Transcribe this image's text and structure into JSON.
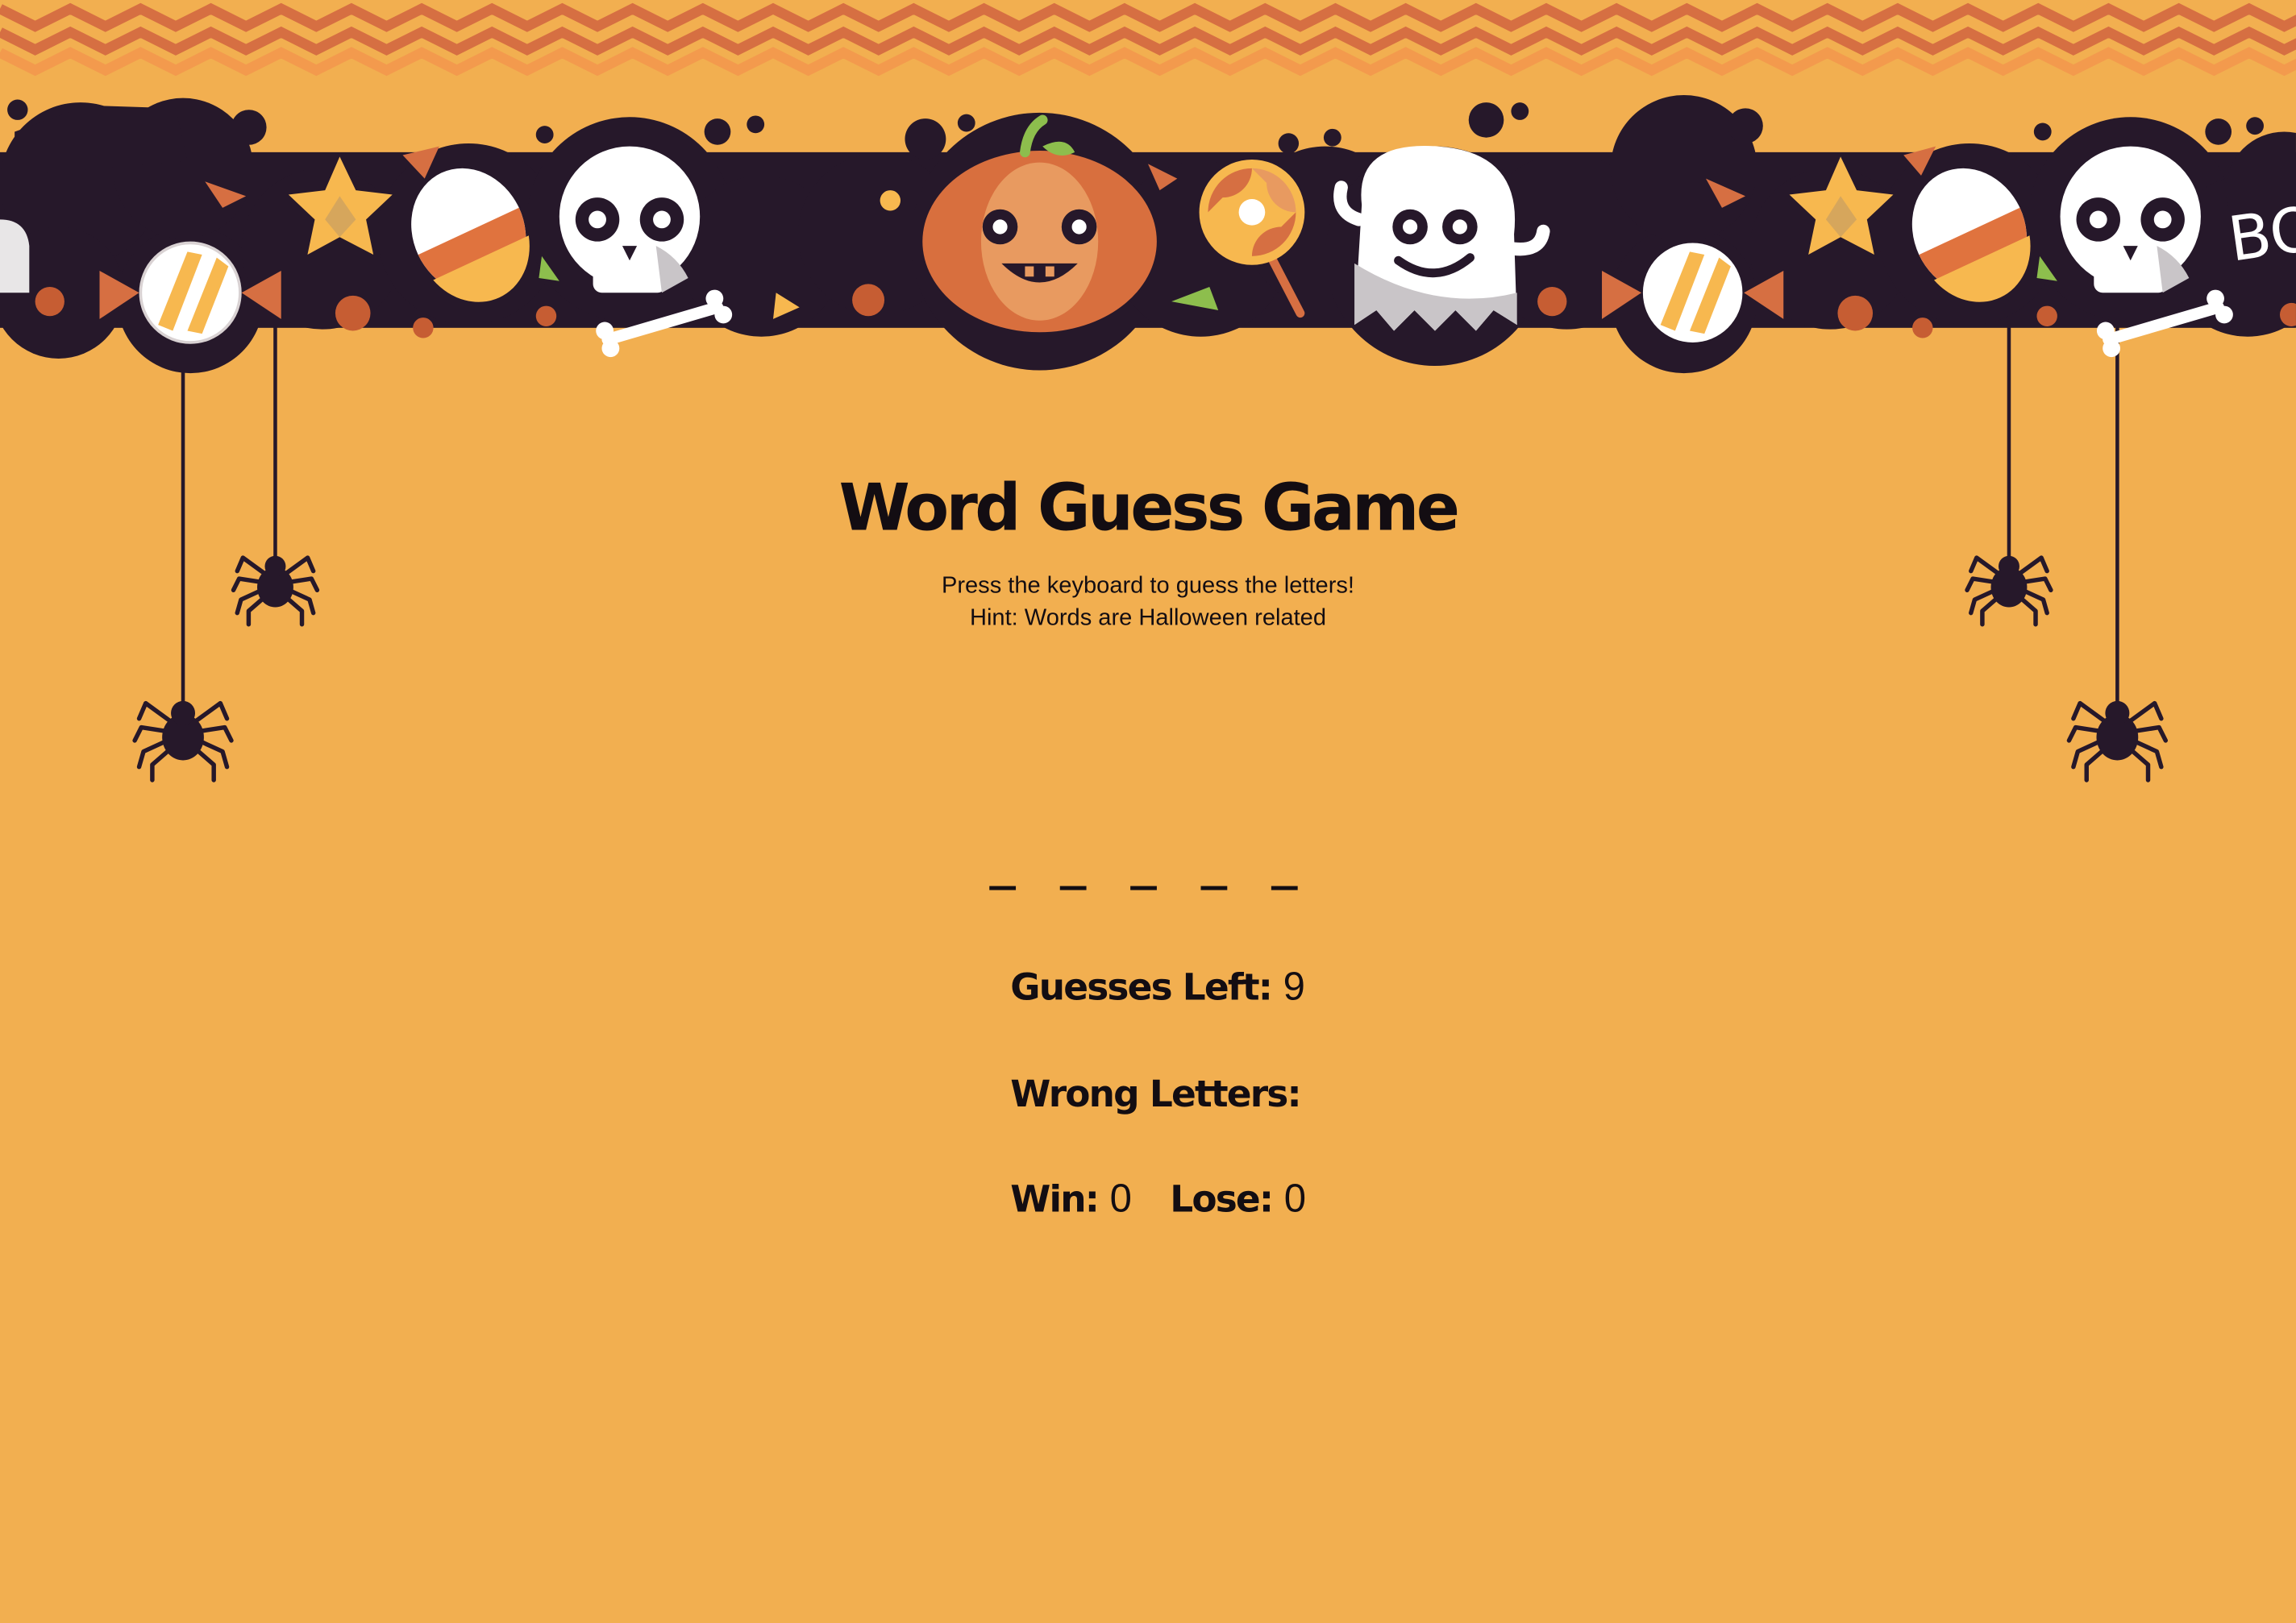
{
  "header": {
    "title": "Word Guess Game",
    "instruction": "Press the keyboard to guess the letters!",
    "hint": "Hint: Words are Halloween related"
  },
  "game": {
    "word_display": "_ _ _ _ _",
    "guesses_left_label": "Guesses Left:",
    "guesses_left_value": "9",
    "wrong_letters_label": "Wrong Letters:",
    "wrong_letters_value": "",
    "win_label": "Win:",
    "win_value": "0",
    "lose_label": "Lose:",
    "lose_value": "0"
  },
  "banner": {
    "partial_text": "BO"
  },
  "colors": {
    "background": "#F2AF50",
    "dark": "#26182A",
    "zigzag_dark": "#D66F42",
    "zigzag_light": "#F39A4D",
    "pumpkin": "#D86F3E",
    "pumpkin_light": "#E89A60",
    "ghost_white": "#FFFFFF",
    "ghost_shadow": "#C9C5C8",
    "candy_orange": "#E0733E",
    "candy_yellow": "#F7B84F",
    "leaf_green": "#8DBE4D"
  }
}
